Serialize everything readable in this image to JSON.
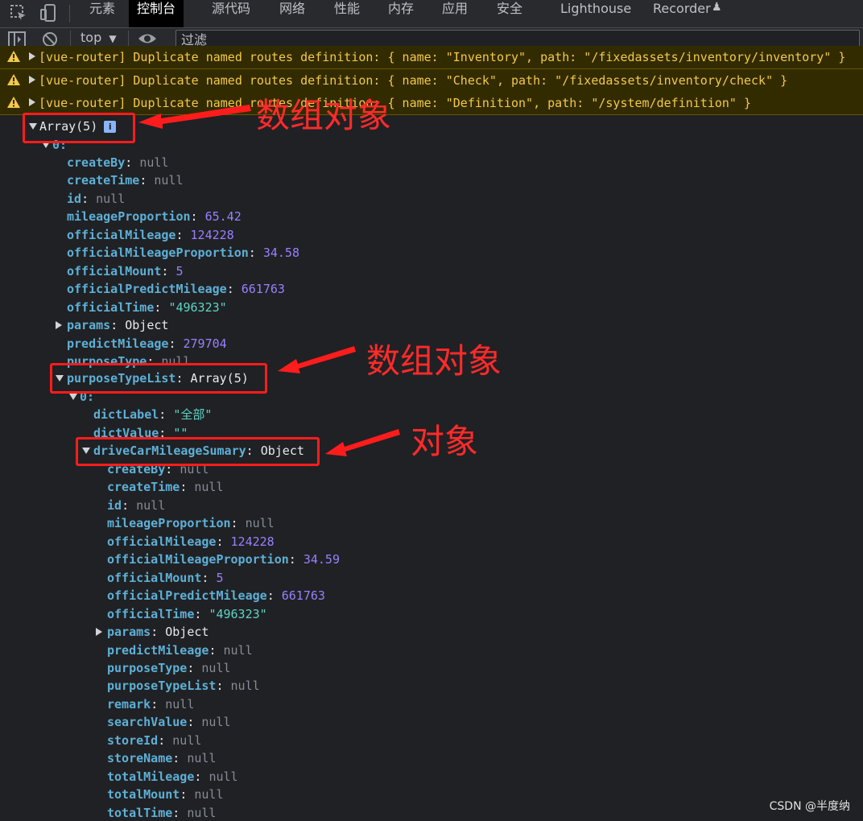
{
  "devtools": {
    "tabs": [
      "元素",
      "控制台",
      "源代码",
      "网络",
      "性能",
      "内存",
      "应用",
      "安全",
      "Lighthouse",
      "Recorder"
    ],
    "active_tab": "控制台",
    "toolbar": {
      "context": "top",
      "filter_placeholder": "过滤"
    }
  },
  "warnings": [
    "[vue-router] Duplicate named routes definition: { name: \"Inventory\", path: \"/fixedassets/inventory/inventory\" }",
    "[vue-router] Duplicate named routes definition: { name: \"Check\", path: \"/fixedassets/inventory/check\" }",
    "[vue-router] Duplicate named routes definition: { name: \"Definition\", path: \"/system/definition\" }"
  ],
  "tree": {
    "root_label": "Array(5)",
    "root_badge": "i",
    "item0_label": "0:",
    "item0_fields": [
      {
        "key": "createBy",
        "value": "null",
        "type": "null"
      },
      {
        "key": "createTime",
        "value": "null",
        "type": "null"
      },
      {
        "key": "id",
        "value": "null",
        "type": "null"
      },
      {
        "key": "mileageProportion",
        "value": "65.42",
        "type": "num"
      },
      {
        "key": "officialMileage",
        "value": "124228",
        "type": "num"
      },
      {
        "key": "officialMileageProportion",
        "value": "34.58",
        "type": "num"
      },
      {
        "key": "officialMount",
        "value": "5",
        "type": "num"
      },
      {
        "key": "officialPredictMileage",
        "value": "661763",
        "type": "num"
      },
      {
        "key": "officialTime",
        "value": "\"496323\"",
        "type": "str"
      },
      {
        "key": "params",
        "value": "Object",
        "type": "obj"
      },
      {
        "key": "predictMileage",
        "value": "279704",
        "type": "num"
      },
      {
        "key": "purposeType",
        "value": "null",
        "type": "null"
      }
    ],
    "purpose_list": {
      "key": "purposeTypeList",
      "value": "Array(5)"
    },
    "sub0_label": "0:",
    "sub0_fields": [
      {
        "key": "dictLabel",
        "value": "\"全部\"",
        "type": "str"
      },
      {
        "key": "dictValue",
        "value": "\"\"",
        "type": "str"
      }
    ],
    "summary": {
      "key": "driveCarMileageSumary",
      "value": "Object"
    },
    "summary_fields": [
      {
        "key": "createBy",
        "value": "null",
        "type": "null"
      },
      {
        "key": "createTime",
        "value": "null",
        "type": "null"
      },
      {
        "key": "id",
        "value": "null",
        "type": "null"
      },
      {
        "key": "mileageProportion",
        "value": "null",
        "type": "null"
      },
      {
        "key": "officialMileage",
        "value": "124228",
        "type": "num"
      },
      {
        "key": "officialMileageProportion",
        "value": "34.59",
        "type": "num"
      },
      {
        "key": "officialMount",
        "value": "5",
        "type": "num"
      },
      {
        "key": "officialPredictMileage",
        "value": "661763",
        "type": "num"
      },
      {
        "key": "officialTime",
        "value": "\"496323\"",
        "type": "str"
      },
      {
        "key": "params",
        "value": "Object",
        "type": "obj"
      },
      {
        "key": "predictMileage",
        "value": "null",
        "type": "null"
      },
      {
        "key": "purposeType",
        "value": "null",
        "type": "null"
      },
      {
        "key": "purposeTypeList",
        "value": "null",
        "type": "null"
      },
      {
        "key": "remark",
        "value": "null",
        "type": "null"
      },
      {
        "key": "searchValue",
        "value": "null",
        "type": "null"
      },
      {
        "key": "storeId",
        "value": "null",
        "type": "null"
      },
      {
        "key": "storeName",
        "value": "null",
        "type": "null"
      },
      {
        "key": "totalMileage",
        "value": "null",
        "type": "null"
      },
      {
        "key": "totalMount",
        "value": "null",
        "type": "null"
      },
      {
        "key": "totalTime",
        "value": "null",
        "type": "null"
      }
    ]
  },
  "annotations": [
    "数组对象",
    "数组对象",
    "对象"
  ],
  "watermark": "CSDN @半度纳",
  "colors": {
    "annotation": "#ff1c1c",
    "key": "#5db0d7",
    "number": "#9980ff",
    "string": "#5cd5c8",
    "warning": "#f2c94c"
  }
}
